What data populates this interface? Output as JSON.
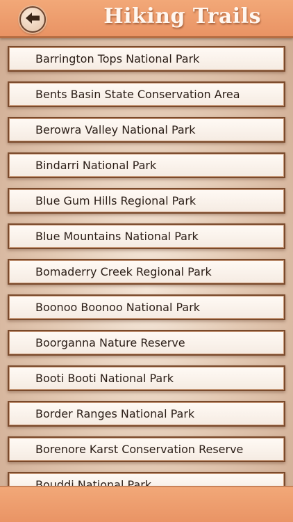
{
  "header": {
    "title": "Hiking Trails",
    "back_icon": "back-arrow-icon"
  },
  "colors": {
    "header_bg": "#ec9a6a",
    "item_border": "#7a4a2c",
    "item_bg": "#fcf5ee",
    "text": "#2a1d16"
  },
  "trails": [
    {
      "label": "Barrington Tops National Park"
    },
    {
      "label": "Bents Basin State Conservation Area"
    },
    {
      "label": "Berowra Valley National Park"
    },
    {
      "label": "Bindarri National Park"
    },
    {
      "label": "Blue Gum Hills Regional Park"
    },
    {
      "label": "Blue Mountains National Park"
    },
    {
      "label": "Bomaderry Creek Regional Park"
    },
    {
      "label": "Boonoo Boonoo National Park"
    },
    {
      "label": "Boorganna Nature Reserve"
    },
    {
      "label": "Booti Booti National Park"
    },
    {
      "label": "Border Ranges National Park"
    },
    {
      "label": "Borenore Karst Conservation Reserve"
    },
    {
      "label": "Bouddi National Park"
    }
  ]
}
